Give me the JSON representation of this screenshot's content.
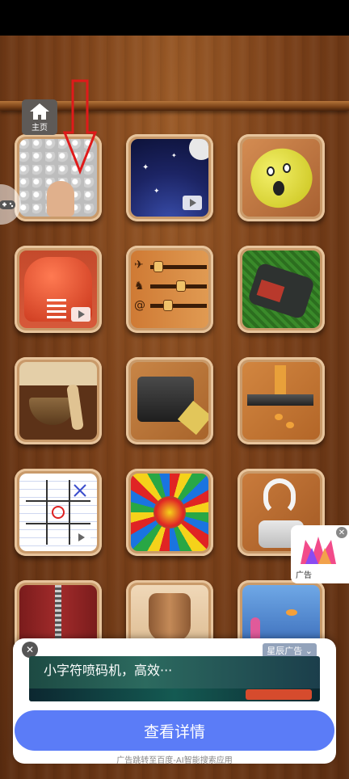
{
  "home_button": {
    "label": "主页"
  },
  "side_tab": {
    "icon": "gamepad-icon"
  },
  "tiles": [
    {
      "name": "bubble-wrap",
      "video": false
    },
    {
      "name": "night-sky",
      "video": true
    },
    {
      "name": "screaming-egg",
      "video": false
    },
    {
      "name": "boxing-glove",
      "video": true
    },
    {
      "name": "animal-sliders",
      "video": false
    },
    {
      "name": "lawn-mower",
      "video": false
    },
    {
      "name": "singing-bowl",
      "video": false
    },
    {
      "name": "pencil-sharpener",
      "video": false
    },
    {
      "name": "knife-carrot",
      "video": false
    },
    {
      "name": "tic-tac-toe",
      "video": true
    },
    {
      "name": "kaleidoscope",
      "video": false
    },
    {
      "name": "toothpaste",
      "video": false
    },
    {
      "name": "zipper",
      "video": false
    },
    {
      "name": "pottery",
      "video": false
    },
    {
      "name": "aquarium",
      "video": false
    }
  ],
  "float_ad": {
    "label": "广告",
    "close": "✕"
  },
  "ad": {
    "close": "✕",
    "tag": "星辰广告 ⌄",
    "banner_title": "小字符喷码机，高效···",
    "cta": "查看详情",
    "footer": "广告跳转至百度-AI智能搜索应用"
  },
  "colors": {
    "cta": "#5b7cf7",
    "arrow": "#e01a1a"
  }
}
